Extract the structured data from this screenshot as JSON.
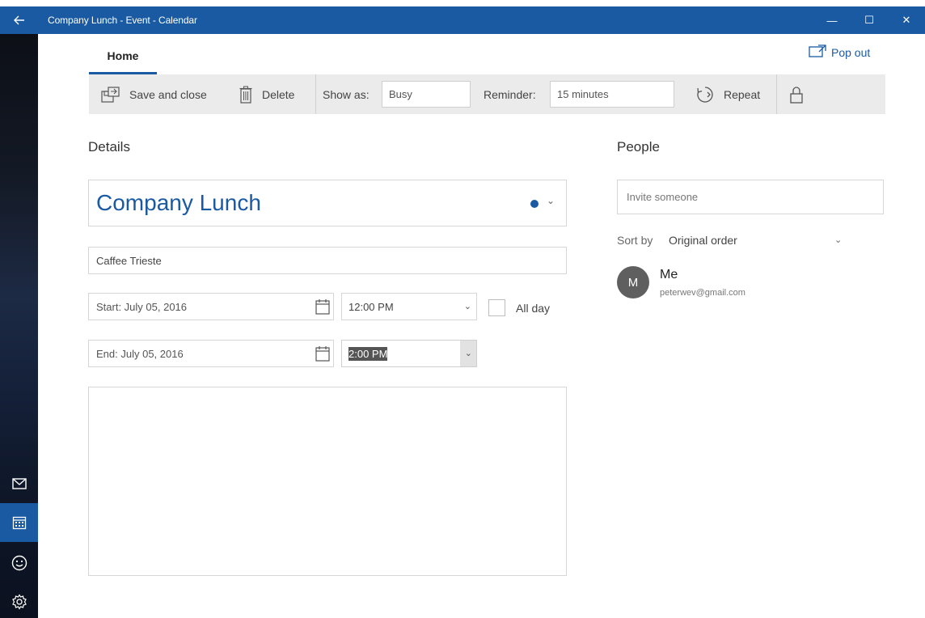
{
  "window": {
    "title": "Company Lunch - Event - Calendar",
    "back_icon": "back-arrow-icon",
    "controls": {
      "minimize": "—",
      "maximize": "☐",
      "close": "✕"
    }
  },
  "rail": {
    "items": [
      {
        "icon": "mail-icon"
      },
      {
        "icon": "calendar-icon",
        "active": true
      },
      {
        "icon": "feedback-smiley-icon"
      },
      {
        "icon": "settings-gear-icon"
      }
    ]
  },
  "tabs": {
    "home": "Home"
  },
  "popout": {
    "label": "Pop out",
    "icon": "popout-icon"
  },
  "toolbar": {
    "save_close": "Save and close",
    "delete": "Delete",
    "show_as_label": "Show as:",
    "show_as_value": "Busy",
    "reminder_label": "Reminder:",
    "reminder_value": "15 minutes",
    "repeat": "Repeat",
    "private_icon": "lock-icon"
  },
  "details": {
    "heading": "Details",
    "title": "Company Lunch",
    "location": "Caffee Trieste",
    "start_date": "Start:  July 05, 2016",
    "start_time": "12:00 PM",
    "end_date": "End:  July 05, 2016",
    "end_time": "2:00 PM",
    "all_day": "All day",
    "calendar_color": "#1a5aa3"
  },
  "people": {
    "heading": "People",
    "invite_placeholder": "Invite someone",
    "sort_label": "Sort by",
    "sort_value": "Original order",
    "attendees": [
      {
        "initial": "M",
        "name": "Me",
        "email": "peterwev@gmail.com"
      }
    ]
  },
  "colors": {
    "accent": "#1a5aa3",
    "toolbar_bg": "#ebebeb"
  }
}
